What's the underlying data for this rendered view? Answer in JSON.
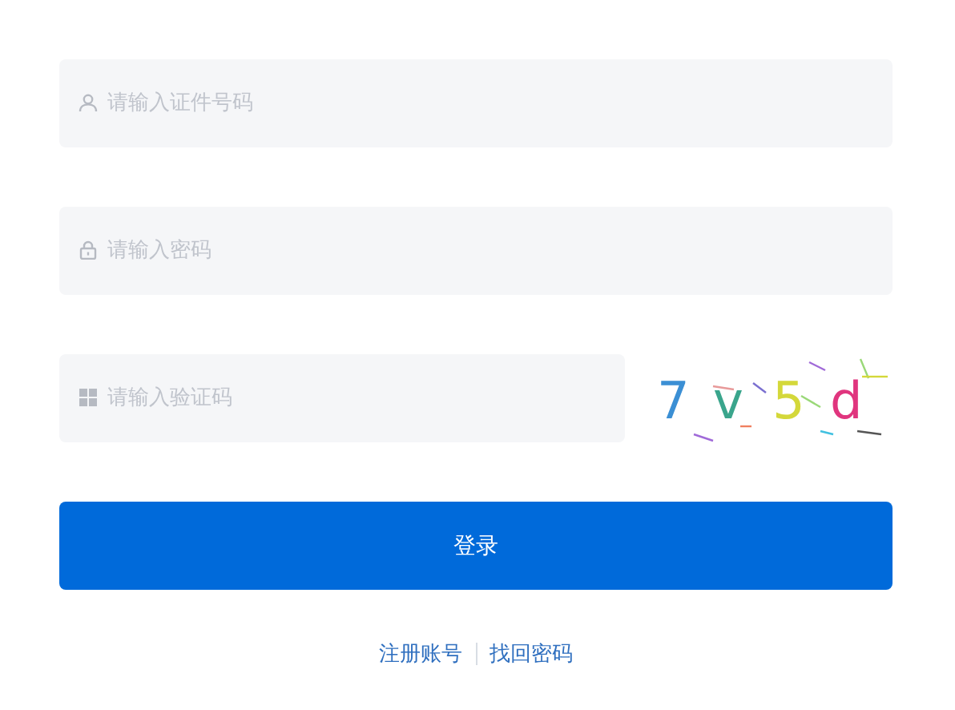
{
  "fields": [
    {
      "kind": "user",
      "placeholder": "请输入证件号码"
    },
    {
      "kind": "lock",
      "placeholder": "请输入密码"
    }
  ],
  "captcha": {
    "placeholder": "请输入验证码",
    "characters": [
      {
        "char": "7",
        "color": "#3b8fd4"
      },
      {
        "char": "v",
        "color": "#3aa58c"
      },
      {
        "char": "5",
        "color": "#d4d83a"
      },
      {
        "char": "d",
        "color": "#e0357e"
      }
    ]
  },
  "login_button": "登录",
  "links": [
    "注册账号",
    "找回密码"
  ]
}
